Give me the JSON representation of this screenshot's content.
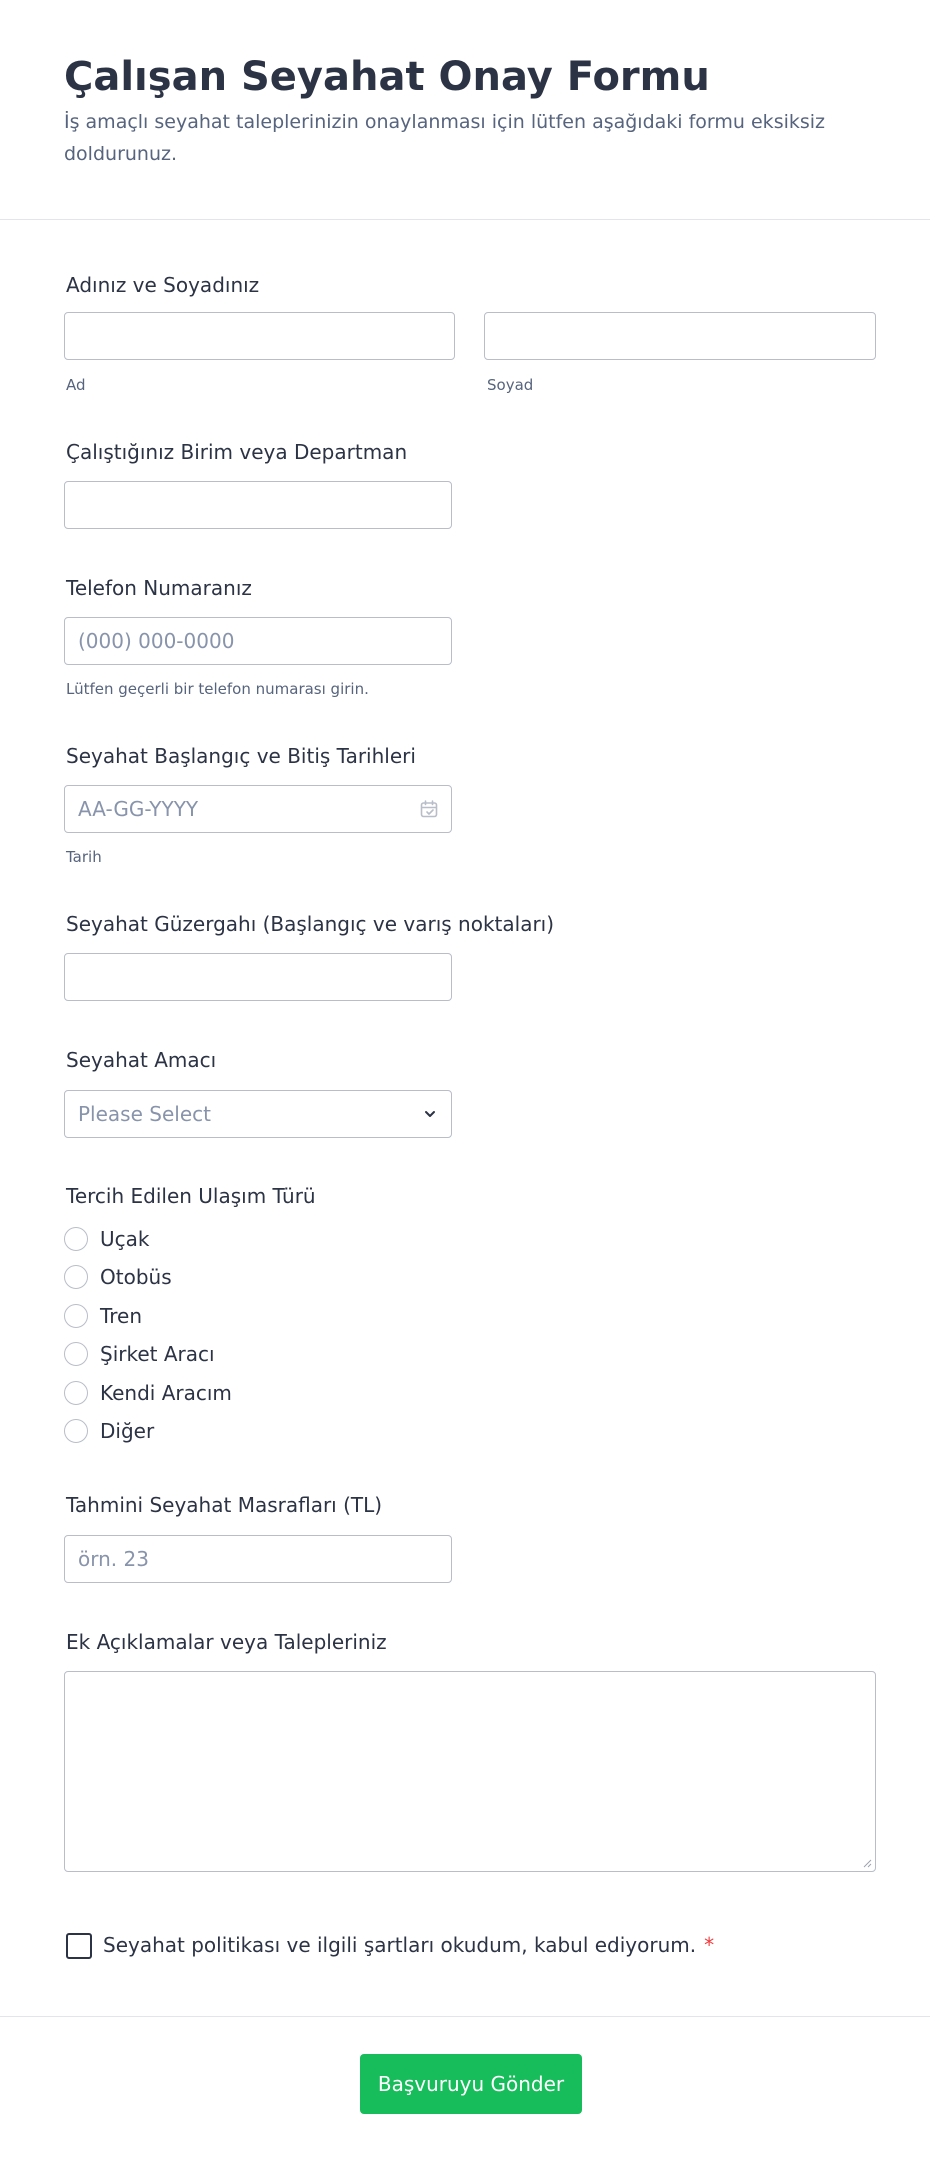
{
  "form": {
    "title": "Çalışan Seyahat Onay Formu",
    "subtitle": "İş amaçlı seyahat taleplerinizin onaylanması için lütfen aşağıdaki formu eksiksiz doldurunuz."
  },
  "fields": {
    "name": {
      "label": "Adınız ve Soyadınız",
      "first_sublabel": "Ad",
      "last_sublabel": "Soyad",
      "first_value": "",
      "last_value": ""
    },
    "department": {
      "label": "Çalıştığınız Birim veya Departman",
      "value": ""
    },
    "phone": {
      "label": "Telefon Numaranız",
      "placeholder": "(000) 000-0000",
      "hint": "Lütfen geçerli bir telefon numarası girin."
    },
    "dates": {
      "label": "Seyahat Başlangıç ve Bitiş Tarihleri",
      "placeholder": "AA-GG-YYYY",
      "sublabel": "Tarih"
    },
    "route": {
      "label": "Seyahat Güzergahı (Başlangıç ve varış noktaları)",
      "value": ""
    },
    "purpose": {
      "label": "Seyahat Amacı",
      "selected": "Please Select"
    },
    "transport": {
      "label": "Tercih Edilen Ulaşım Türü",
      "options": [
        "Uçak",
        "Otobüs",
        "Tren",
        "Şirket Aracı",
        "Kendi Aracım",
        "Diğer"
      ]
    },
    "expenses": {
      "label": "Tahmini Seyahat Masrafları (TL)",
      "placeholder": "örn. 23"
    },
    "notes": {
      "label": "Ek Açıklamalar veya Talepleriniz",
      "value": ""
    },
    "consent": {
      "text": "Seyahat politikası ve ilgili şartları okudum, kabul ediyorum.",
      "required_mark": "*"
    }
  },
  "submit": {
    "label": "Başvuruyu Gönder"
  },
  "colors": {
    "text": "#2c3345",
    "muted": "#57647e",
    "placeholder": "#8894ab",
    "border": "#b8bdc9",
    "submit": "#18bd5b",
    "required": "#f23a3c"
  },
  "icons": {
    "date": "calendar-icon",
    "select": "chevron-down-icon",
    "textarea": "resize-handle-icon"
  }
}
